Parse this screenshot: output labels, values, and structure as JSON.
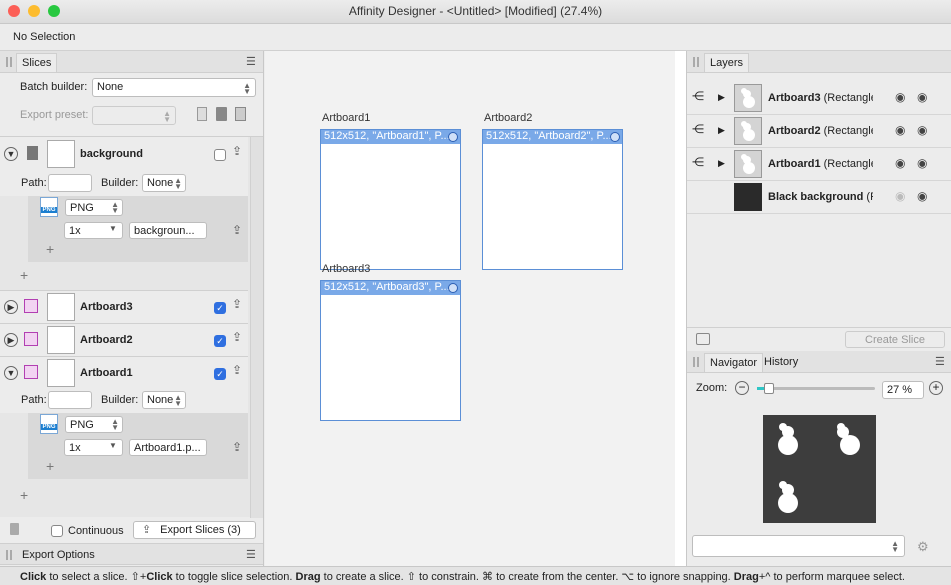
{
  "window": {
    "title": "Affinity Designer - <Untitled> [Modified] (27.4%)"
  },
  "context_toolbar": {
    "selection_text": "No Selection"
  },
  "slices_panel": {
    "tab": "Slices",
    "batch_builder_label": "Batch builder:",
    "batch_builder_value": "None",
    "export_preset_label": "Export preset:",
    "slices": [
      {
        "name": "background",
        "path_label": "Path:",
        "builder_label": "Builder:",
        "builder_value": "None",
        "format": "PNG",
        "scale": "1x",
        "filename": "backgroun..."
      },
      {
        "name": "Artboard3"
      },
      {
        "name": "Artboard2"
      },
      {
        "name": "Artboard1",
        "path_label": "Path:",
        "builder_label": "Builder:",
        "builder_value": "None",
        "format": "PNG",
        "scale": "1x",
        "filename": "Artboard1.p..."
      }
    ],
    "continuous_label": "Continuous",
    "export_button": "Export Slices (3)",
    "export_options_tab": "Export Options"
  },
  "canvas": {
    "artboards": [
      {
        "label": "Artboard1",
        "header": "512x512, \"Artboard1\", P..."
      },
      {
        "label": "Artboard2",
        "header": "512x512, \"Artboard2\", P..."
      },
      {
        "label": "Artboard3",
        "header": "512x512, \"Artboard3\", P..."
      }
    ]
  },
  "layers_panel": {
    "tab": "Layers",
    "layers": [
      {
        "name": "Artboard3",
        "suffix": " (Rectangle"
      },
      {
        "name": "Artboard2",
        "suffix": " (Rectangle"
      },
      {
        "name": "Artboard1",
        "suffix": " (Rectangle"
      },
      {
        "name": "Black background",
        "suffix": " (R"
      }
    ],
    "create_slice_button": "Create Slice"
  },
  "navigator_panel": {
    "tab_navigator": "Navigator",
    "tab_history": "History",
    "zoom_label": "Zoom:",
    "zoom_value": "27 %",
    "zoom_fraction": 0.1
  },
  "statusbar": {
    "parts": [
      {
        "t": "Click",
        "b": true
      },
      {
        "t": " to select a slice. ⇧+",
        "b": false
      },
      {
        "t": "Click",
        "b": true
      },
      {
        "t": " to toggle slice selection. ",
        "b": false
      },
      {
        "t": "Drag",
        "b": true
      },
      {
        "t": " to create a slice. ⇧ to constrain. ⌘ to create from the center. ⌥ to ignore snapping. ",
        "b": false
      },
      {
        "t": "Drag",
        "b": true
      },
      {
        "t": "+^ to perform marquee select.",
        "b": false
      }
    ]
  },
  "colors": {
    "accent": "#2f6fe0",
    "artboard_header": "#7aa9e8",
    "close": "#fc5f57",
    "minimize": "#fdbc2e",
    "zoom": "#28c840"
  }
}
